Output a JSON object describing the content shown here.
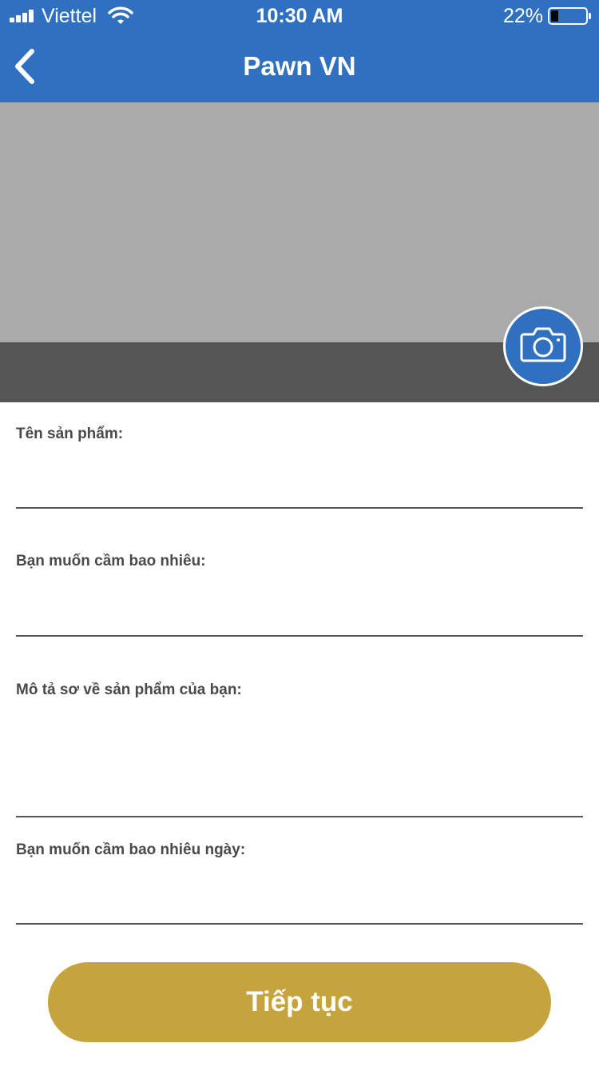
{
  "status_bar": {
    "carrier": "Viettel",
    "time": "10:30 AM",
    "battery_percent": "22%",
    "battery_level": 0.22
  },
  "nav": {
    "title": "Pawn VN",
    "back_icon": "chevron-left-icon"
  },
  "image_area": {
    "camera_icon": "camera-icon"
  },
  "form": {
    "product_name_label": "Tên sản phẩm:",
    "product_name_value": "",
    "amount_label": "Bạn muốn cầm bao nhiêu:",
    "amount_value": "",
    "description_label": "Mô tả sơ về sản phẩm của bạn:",
    "description_value": "",
    "days_label": "Bạn muốn cầm bao nhiêu ngày:",
    "days_value": ""
  },
  "actions": {
    "continue_label": "Tiếp tục"
  },
  "colors": {
    "primary": "#3070c0",
    "accent": "#c5a43d",
    "image_placeholder": "#aaaaaa",
    "image_strip": "#555555"
  }
}
